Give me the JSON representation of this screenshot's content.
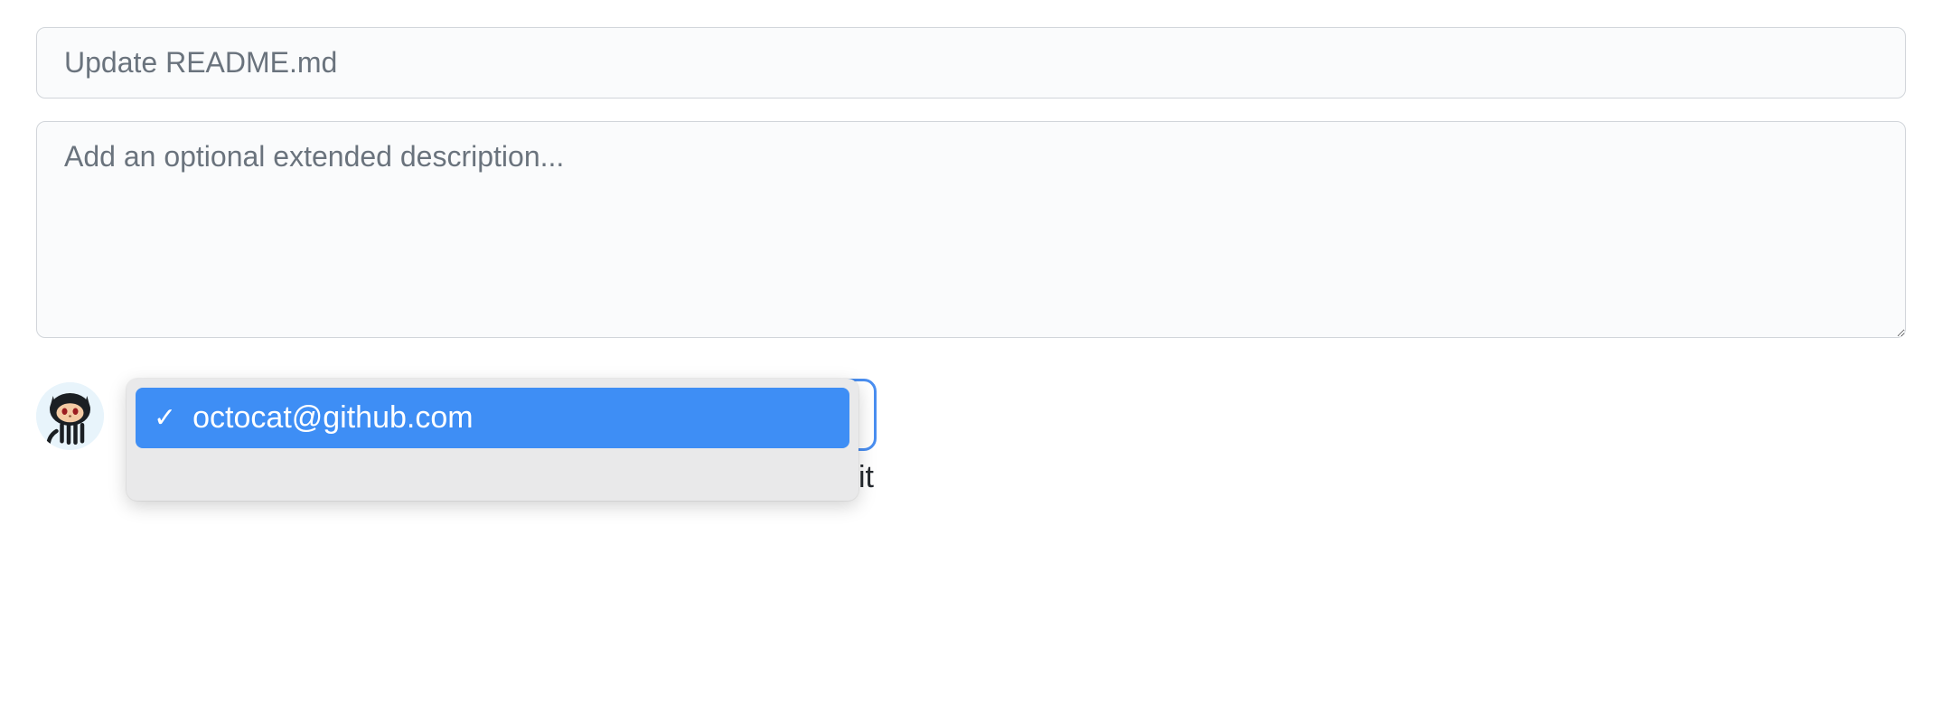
{
  "commit": {
    "summary_placeholder": "Update README.md",
    "description_placeholder": "Add an optional extended description...",
    "summary_value": "",
    "description_value": ""
  },
  "author_dropdown": {
    "selected": "octocat@github.com",
    "check_glyph": "✓",
    "hidden_trailing_text": "it"
  },
  "colors": {
    "selection_blue": "#3e8ef5",
    "panel_bg": "#e9e9ea",
    "input_bg": "#fafbfc",
    "border": "#d1d5da"
  }
}
